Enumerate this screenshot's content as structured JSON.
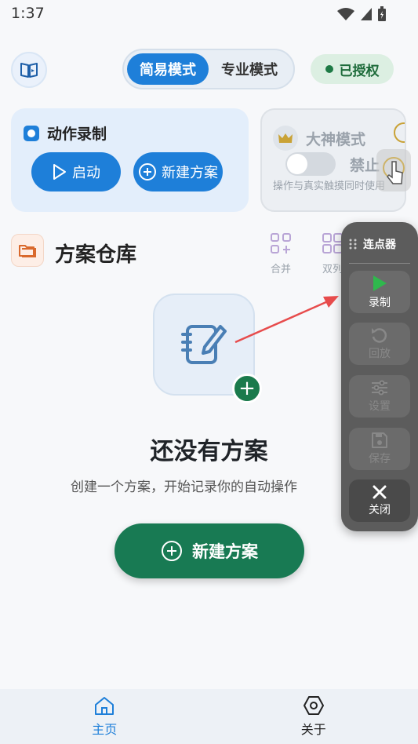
{
  "status": {
    "time": "1:37"
  },
  "header": {
    "mode_simple": "简易模式",
    "mode_pro": "专业模式",
    "license": "已授权"
  },
  "record_card": {
    "title": "动作录制",
    "start_label": "启动",
    "new_plan_label": "新建方案"
  },
  "god_card": {
    "title": "大神模式",
    "forbid_label": "禁止",
    "note": "操作与真实触摸同时使用"
  },
  "repo": {
    "title": "方案仓库",
    "merge_label": "合并",
    "double_label": "双列"
  },
  "empty": {
    "title": "还没有方案",
    "subtitle": "创建一个方案，开始记录你的自动操作",
    "button_label": "新建方案"
  },
  "nav": {
    "home_label": "主页",
    "about_label": "关于"
  },
  "float_panel": {
    "title": "连点器",
    "record_label": "录制",
    "replay_label": "回放",
    "settings_label": "设置",
    "save_label": "保存",
    "close_label": "关闭"
  },
  "colors": {
    "primary": "#1e7fd9",
    "success": "#187a53",
    "panel": "#5c5c5c",
    "play_green": "#2fb84d",
    "arrow_red": "#e74c4c"
  }
}
